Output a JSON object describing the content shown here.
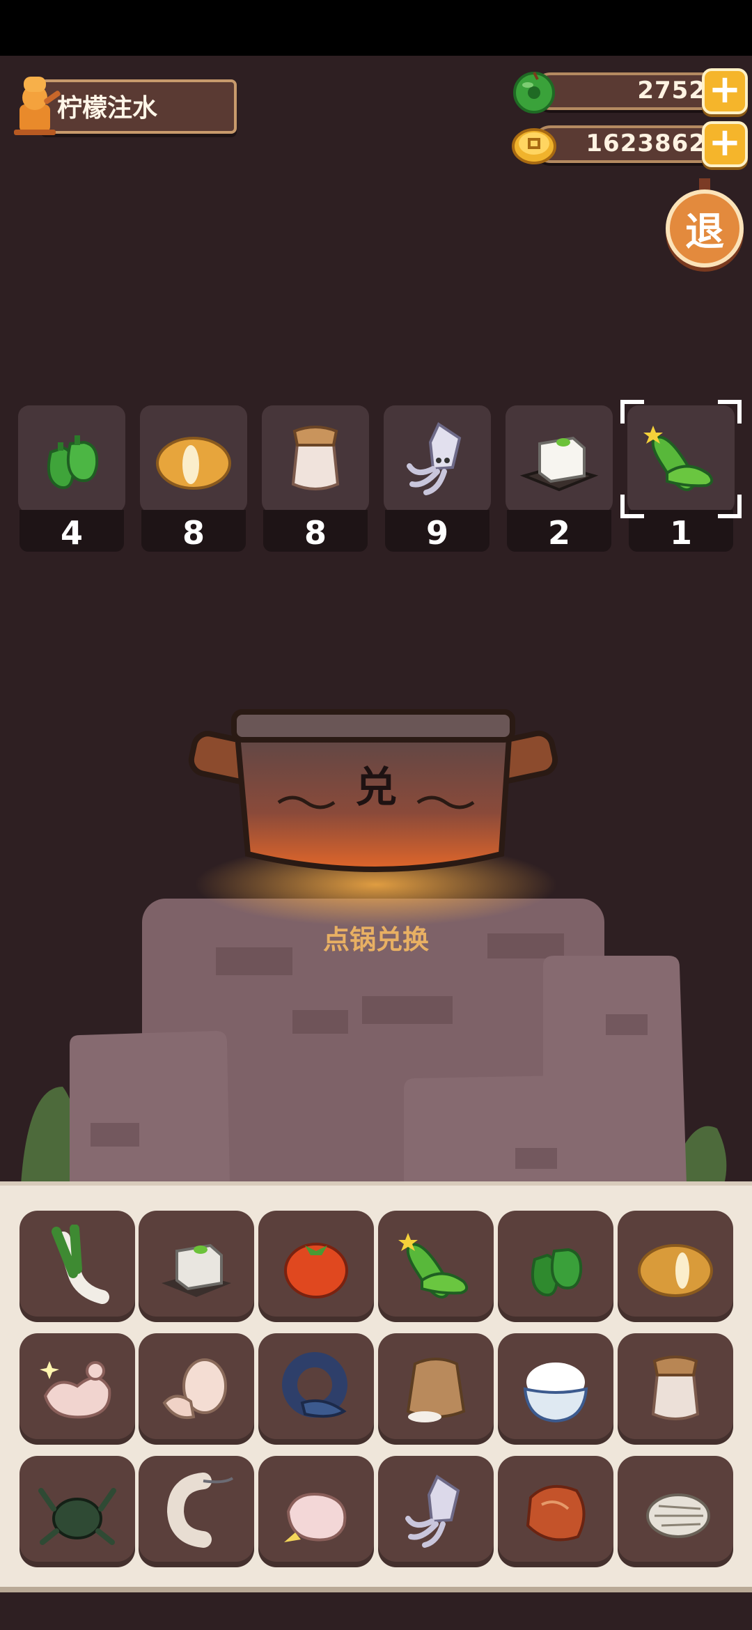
{
  "player": {
    "name": "柠檬注水"
  },
  "currency": {
    "jade": {
      "value": "2752",
      "icon": "jade-coin-icon"
    },
    "coins": {
      "value": "1623862",
      "icon": "gold-coin-icon"
    }
  },
  "exit_button": {
    "label": "退"
  },
  "slots": [
    {
      "item": "green-pepper",
      "count": "4"
    },
    {
      "item": "potato",
      "count": "8"
    },
    {
      "item": "jar",
      "count": "8"
    },
    {
      "item": "squid",
      "count": "9"
    },
    {
      "item": "tofu",
      "count": "2"
    },
    {
      "item": "cucumber",
      "count": "1",
      "selected": true
    }
  ],
  "pot": {
    "emblem": "兑",
    "action_label": "点锅兑换"
  },
  "inventory": [
    "leek",
    "tofu",
    "tomato",
    "cucumber",
    "green-pepper",
    "potato",
    "chicken",
    "egg",
    "fish",
    "flour-sack",
    "rice-bowl",
    "jar",
    "crab",
    "shrimp",
    "duck",
    "squid",
    "meat",
    "clam"
  ],
  "colors": {
    "background": "#2e1f22",
    "accent": "#f5b52b",
    "label": "#e8b063"
  }
}
